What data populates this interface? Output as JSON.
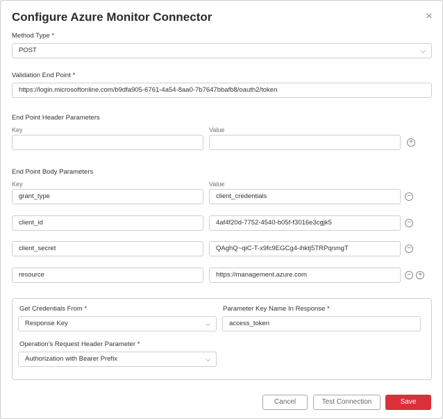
{
  "dialog": {
    "title": "Configure Azure Monitor Connector",
    "close_icon": "×"
  },
  "method": {
    "label": "Method Type *",
    "value": "POST"
  },
  "validation": {
    "label": "Validation End Point *",
    "value": "https://login.microsoftonline.com/b9dfa905-6761-4a54-8aa0-7b7647bbafb8/oauth2/token"
  },
  "header_params": {
    "label": "End Point Header Parameters",
    "key_label": "Key",
    "value_label": "Value",
    "key_value": "",
    "value_value": ""
  },
  "body_params": {
    "label": "End Point Body Parameters",
    "key_label": "Key",
    "value_label": "Value",
    "rows": [
      {
        "key": "grant_type",
        "value": "client_credentials"
      },
      {
        "key": "client_id",
        "value": "4af4f20d-7752-4540-b05f-f3016e3cgjk5"
      },
      {
        "key": "client_secret",
        "value": "QAghQ~qiC-T-x9fc9EGCg4-ihktj5TRPqnmgT"
      },
      {
        "key": "resource",
        "value": "https://management.azure.com"
      }
    ]
  },
  "credentials": {
    "from_label": "Get Credentials From *",
    "from_value": "Response Key",
    "key_name_label": "Parameter Key Name In Response *",
    "key_name_value": "access_token",
    "header_param_label": "Operation's Request Header Parameter *",
    "header_param_value": "Authorization with Bearer Prefix"
  },
  "footer": {
    "cancel_label": "Cancel",
    "test_label": "Test Connection",
    "save_label": "Save"
  },
  "icons": {
    "chevron": "⌵",
    "plus": "+",
    "minus": "−"
  },
  "colors": {
    "primary": "#d9303a",
    "border": "#cfcfcf"
  }
}
